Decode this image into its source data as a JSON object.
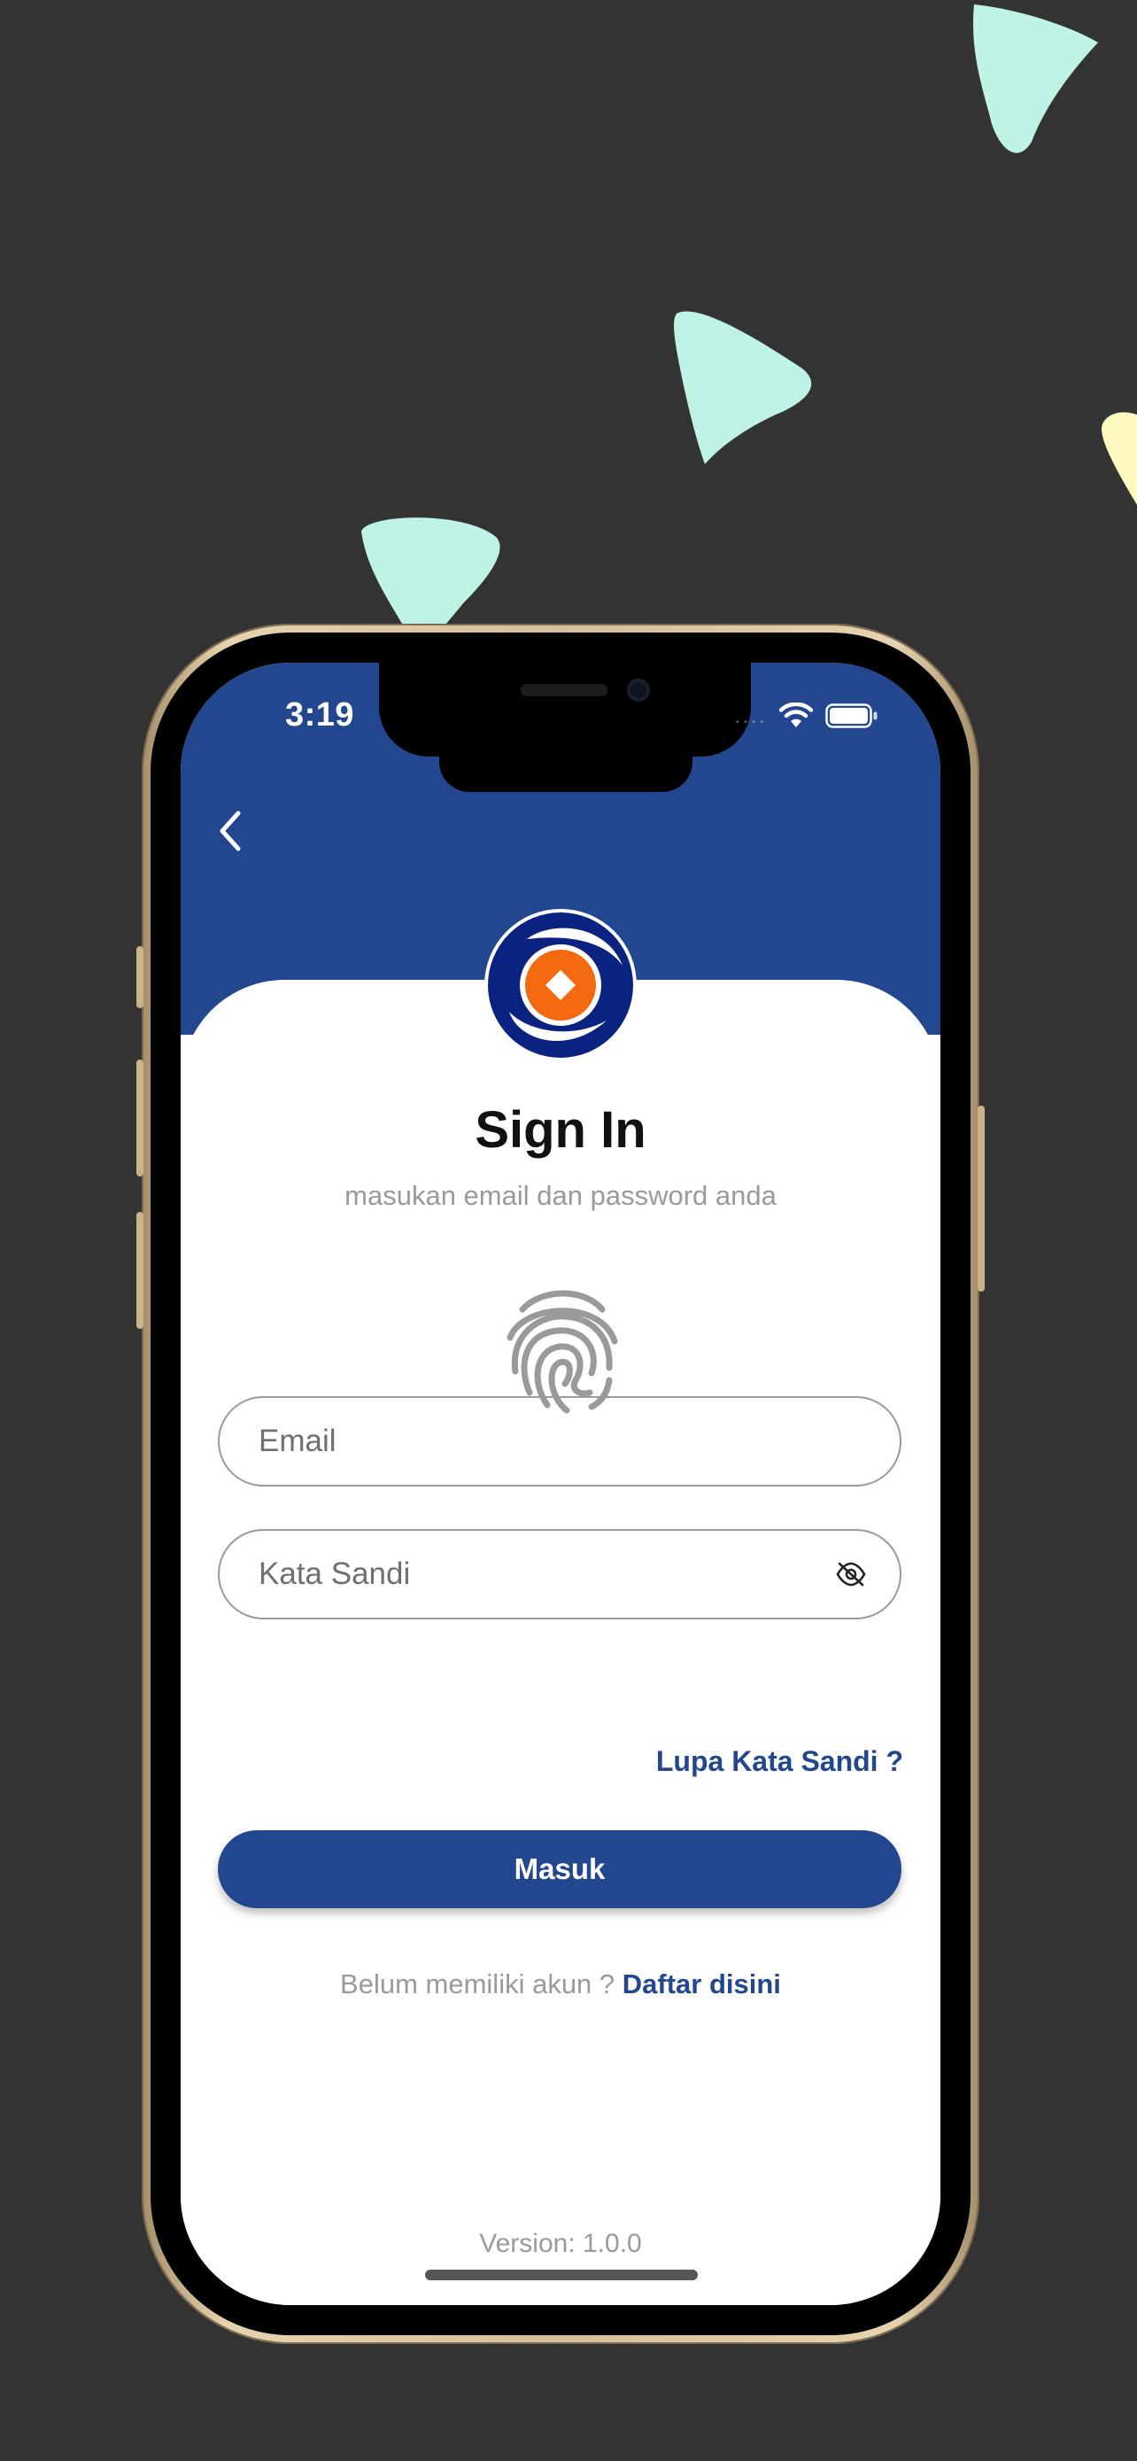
{
  "status_bar": {
    "time": "3:19",
    "signal": "....",
    "icons": [
      "wifi-icon",
      "battery-icon"
    ]
  },
  "header": {
    "back_icon": "chevron-left-icon",
    "logo": "app-logo"
  },
  "form": {
    "title": "Sign In",
    "subtitle": "masukan email dan password anda",
    "fingerprint_icon": "fingerprint-icon",
    "email_placeholder": "Email",
    "password_placeholder": "Kata Sandi",
    "password_toggle_icon": "eye-off-icon",
    "forgot_password": "Lupa Kata Sandi ?",
    "submit_label": "Masuk",
    "register_prompt": "Belum memiliki akun ?",
    "register_link": "Daftar disini"
  },
  "footer": {
    "version": "Version: 1.0.0"
  },
  "colors": {
    "background": "#333333",
    "primary": "#22478f",
    "accent_orange": "#f36a10",
    "logo_navy": "#0b2380",
    "deco_mint": "#bff3e5",
    "deco_yellow": "#fff9c2",
    "muted_text": "#9a9a9a"
  }
}
